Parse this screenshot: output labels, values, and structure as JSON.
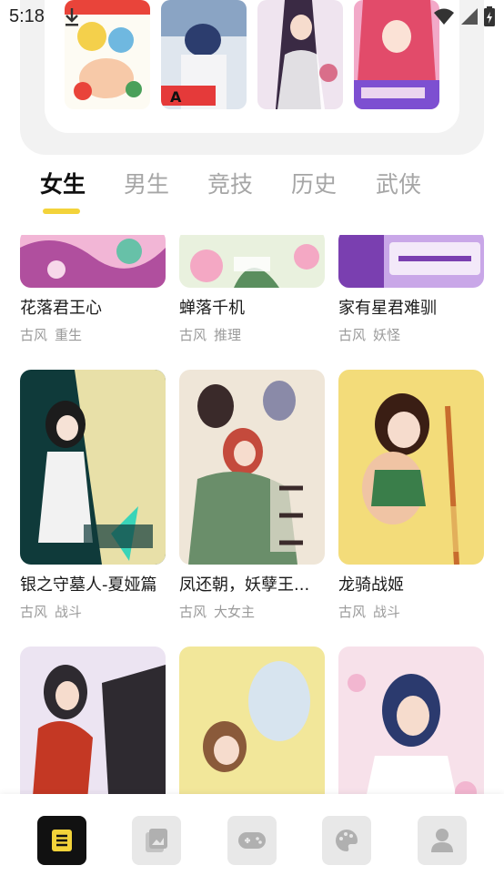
{
  "status_bar": {
    "time": "5:18",
    "download_icon": "download-icon",
    "wifi_icon": "wifi-icon",
    "signal_icon": "signal-icon",
    "battery_icon": "battery-icon"
  },
  "banner": {
    "covers": [
      {
        "name": "banner-cover-1",
        "palette": [
          "#f4d04b",
          "#e9443a",
          "#6fb8e0"
        ]
      },
      {
        "name": "banner-cover-2",
        "palette": [
          "#2c3d6e",
          "#dfe6ee",
          "#e53a3a"
        ]
      },
      {
        "name": "banner-cover-3",
        "palette": [
          "#efe4ef",
          "#3a2a44",
          "#d96e8a"
        ]
      },
      {
        "name": "banner-cover-4",
        "palette": [
          "#f2a9c8",
          "#e24b6a",
          "#7d4fd1"
        ]
      }
    ]
  },
  "tabs": [
    {
      "label": "女生",
      "active": true
    },
    {
      "label": "男生",
      "active": false
    },
    {
      "label": "竞技",
      "active": false
    },
    {
      "label": "历史",
      "active": false
    },
    {
      "label": "武侠",
      "active": false
    }
  ],
  "comics": [
    {
      "title": "花落君王心",
      "tags": [
        "古风",
        "重生"
      ],
      "palette": [
        "#f2b6d6",
        "#b04f9e",
        "#67c1a8"
      ]
    },
    {
      "title": "蝉落千机",
      "tags": [
        "古风",
        "推理"
      ],
      "palette": [
        "#e9f1de",
        "#f4a8c4",
        "#5a8e5e"
      ]
    },
    {
      "title": "家有星君难驯",
      "tags": [
        "古风",
        "妖怪"
      ],
      "palette": [
        "#c9a7e8",
        "#7a3fb0",
        "#f7f1fb"
      ]
    },
    {
      "title": "银之守墓人-夏娅篇",
      "tags": [
        "古风",
        "战斗"
      ],
      "palette": [
        "#0f3a3a",
        "#e8e0a8",
        "#3ad4b8"
      ]
    },
    {
      "title": "凤还朝，妖孽王...",
      "tags": [
        "古风",
        "大女主"
      ],
      "palette": [
        "#efe6d8",
        "#c44a3c",
        "#3a2a2a"
      ]
    },
    {
      "title": "龙骑战姬",
      "tags": [
        "古风",
        "战斗"
      ],
      "palette": [
        "#f3dc7a",
        "#c86c2e",
        "#3a7e4a"
      ]
    },
    {
      "title": "",
      "tags": [],
      "palette": [
        "#ece4f2",
        "#c43824",
        "#2e2a30"
      ]
    },
    {
      "title": "",
      "tags": [],
      "palette": [
        "#f2e79a",
        "#d7e4ef",
        "#6b8e3c"
      ]
    },
    {
      "title": "",
      "tags": [],
      "palette": [
        "#f7e1ea",
        "#2b3a6e",
        "#ffffff"
      ]
    }
  ],
  "bottom_nav": [
    {
      "name": "nav-comic-book-icon",
      "active": true
    },
    {
      "name": "nav-gallery-icon",
      "active": false
    },
    {
      "name": "nav-gamepad-icon",
      "active": false
    },
    {
      "name": "nav-palette-icon",
      "active": false
    },
    {
      "name": "nav-profile-icon",
      "active": false
    }
  ],
  "colors": {
    "accent": "#f3d33a",
    "active_nav": "#111111",
    "inactive_nav": "#e8e8e8",
    "tab_inactive": "#a6a6a6",
    "tag_text": "#9a9a9a"
  }
}
